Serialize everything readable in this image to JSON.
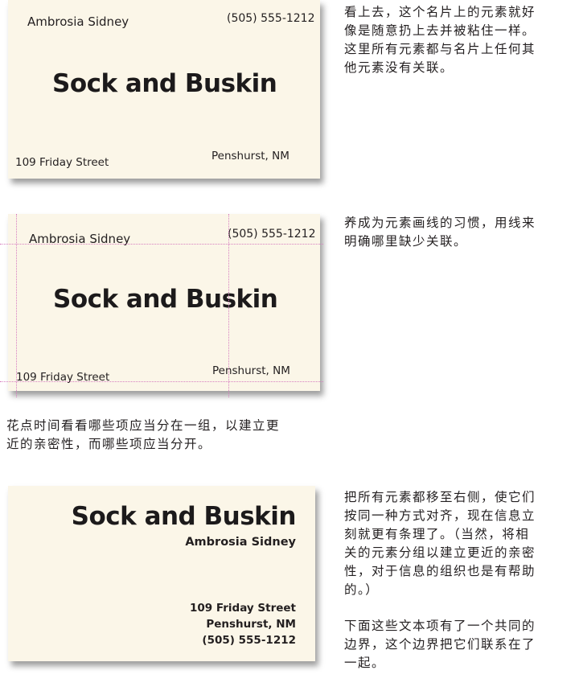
{
  "card1": {
    "name": "Ambrosia Sidney",
    "phone": "(505) 555-1212",
    "title": "Sock and Buskin",
    "street": "109 Friday Street",
    "city": "Penshurst, NM"
  },
  "card2": {
    "name": "Ambrosia Sidney",
    "phone": "(505) 555-1212",
    "title": "Sock and Buskin",
    "street": "109 Friday Street",
    "city": "Penshurst, NM"
  },
  "card3": {
    "title": "Sock and Buskin",
    "name": "Ambrosia Sidney",
    "street": "109 Friday Street",
    "city": "Penshurst, NM",
    "phone": "(505) 555-1212"
  },
  "captions": {
    "cap1": [
      "看上去，这个名片上的元素就好",
      "像是随意扔上去并被粘住一样。",
      "这里所有元素都与名片上任何其",
      "他元素没有关联。"
    ],
    "cap2": [
      "养成为元素画线的习惯，用线来",
      "明确哪里缺少关联。"
    ],
    "cap3": [
      "花点时间看看哪些项应当分在一组，以建立更",
      "近的亲密性，而哪些项应当分开。"
    ],
    "cap4": [
      "把所有元素都移至右侧，使它们",
      "按同一种方式对齐，现在信息立",
      "刻就更有条理了。（当然，将相",
      "关的元素分组以建立更近的亲密",
      "性，对于信息的组织也是有帮助",
      "的。）"
    ],
    "cap5": [
      "下面这些文本项有了一个共同的",
      "边界，这个边界把它们联系在了",
      "一起。"
    ]
  }
}
